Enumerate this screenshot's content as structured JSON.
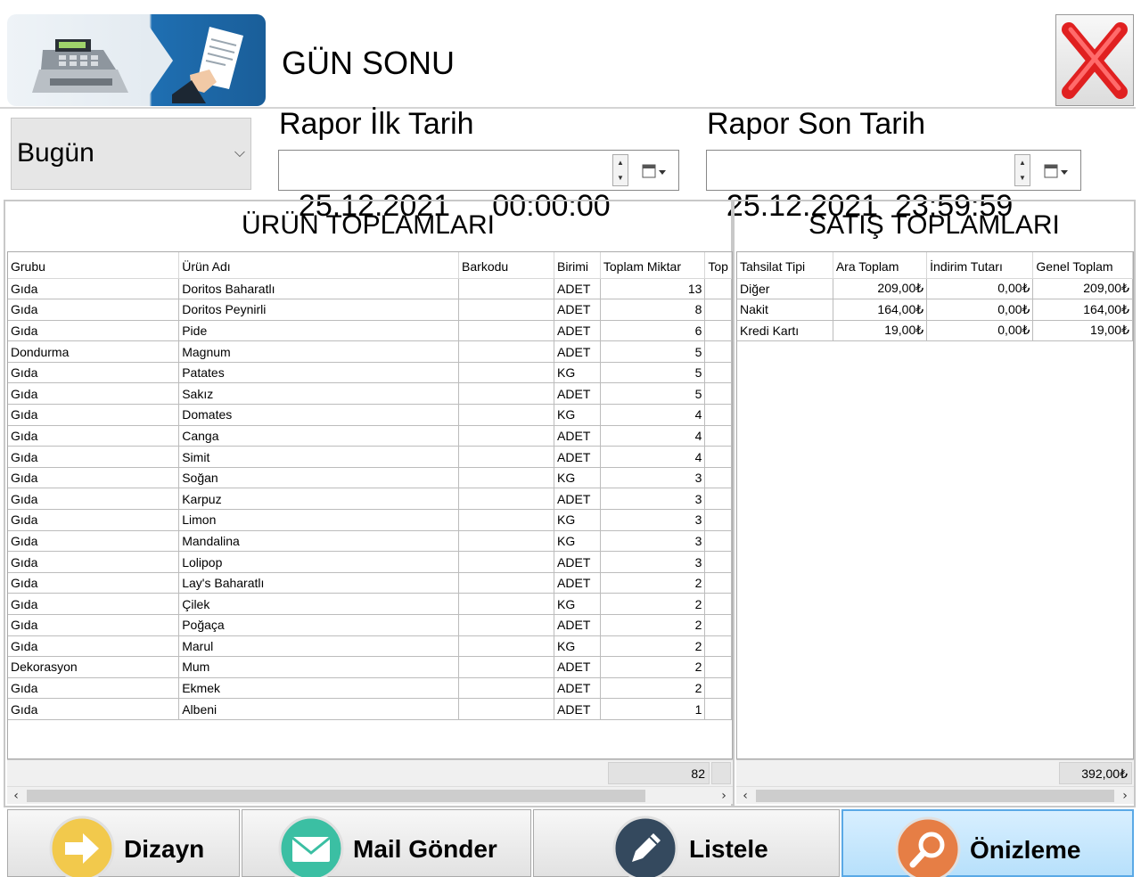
{
  "header": {
    "title": "GÜN SONU"
  },
  "period": {
    "selected": "Bugün"
  },
  "date_start": {
    "label": "Rapor İlk Tarih",
    "value": "25.12.2021     00:00:00"
  },
  "date_end": {
    "label": "Rapor Son Tarih",
    "value": "25.12.2021  23:59:59"
  },
  "products": {
    "title": "ÜRÜN TOPLAMLARI",
    "columns": [
      "Grubu",
      "Ürün Adı",
      "Barkodu",
      "Birimi",
      "Toplam Miktar",
      "Top"
    ],
    "rows": [
      [
        "Gıda",
        "Doritos Baharatlı",
        "",
        "ADET",
        "13"
      ],
      [
        "Gıda",
        "Doritos Peynirli",
        "",
        "ADET",
        "8"
      ],
      [
        "Gıda",
        "Pide",
        "",
        "ADET",
        "6"
      ],
      [
        "Dondurma",
        "Magnum",
        "",
        "ADET",
        "5"
      ],
      [
        "Gıda",
        "Patates",
        "",
        "KG",
        "5"
      ],
      [
        "Gıda",
        "Sakız",
        "",
        "ADET",
        "5"
      ],
      [
        "Gıda",
        "Domates",
        "",
        "KG",
        "4"
      ],
      [
        "Gıda",
        "Canga",
        "",
        "ADET",
        "4"
      ],
      [
        "Gıda",
        "Simit",
        "",
        "ADET",
        "4"
      ],
      [
        "Gıda",
        "Soğan",
        "",
        "KG",
        "3"
      ],
      [
        "Gıda",
        "Karpuz",
        "",
        "ADET",
        "3"
      ],
      [
        "Gıda",
        "Limon",
        "",
        "KG",
        "3"
      ],
      [
        "Gıda",
        "Mandalina",
        "",
        "KG",
        "3"
      ],
      [
        "Gıda",
        "Lolipop",
        "",
        "ADET",
        "3"
      ],
      [
        "Gıda",
        "Lay's Baharatlı",
        "",
        "ADET",
        "2"
      ],
      [
        "Gıda",
        "Çilek",
        "",
        "KG",
        "2"
      ],
      [
        "Gıda",
        "Poğaça",
        "",
        "ADET",
        "2"
      ],
      [
        "Gıda",
        "Marul",
        "",
        "KG",
        "2"
      ],
      [
        "Dekorasyon",
        "Mum",
        "",
        "ADET",
        "2"
      ],
      [
        "Gıda",
        "Ekmek",
        "",
        "ADET",
        "2"
      ],
      [
        "Gıda",
        "Albeni",
        "",
        "ADET",
        "1"
      ]
    ],
    "total": "82"
  },
  "sales": {
    "title": "SATIŞ TOPLAMLARI",
    "columns": [
      "Tahsilat Tipi",
      "Ara Toplam",
      "İndirim Tutarı",
      "Genel Toplam"
    ],
    "rows": [
      [
        "Diğer",
        "209,00₺",
        "0,00₺",
        "209,00₺"
      ],
      [
        "Nakit",
        "164,00₺",
        "0,00₺",
        "164,00₺"
      ],
      [
        "Kredi Kartı",
        "19,00₺",
        "0,00₺",
        "19,00₺"
      ]
    ],
    "total": "392,00₺"
  },
  "buttons": {
    "design": "Dizayn",
    "mail": "Mail Gönder",
    "list": "Listele",
    "preview": "Önizleme"
  },
  "colors": {
    "design_icon": "#f2c94c",
    "mail_icon": "#3bbfa3",
    "list_icon": "#34495e",
    "preview_icon": "#e67e45",
    "active_button": "#b7e0fb",
    "close_red": "#e02020"
  },
  "icons": {
    "logo": "cash-register-icon",
    "close": "close-icon",
    "design": "arrow-right-icon",
    "mail": "envelope-icon",
    "list": "pencil-icon",
    "preview": "magnifier-icon",
    "calendar": "calendar-icon"
  }
}
